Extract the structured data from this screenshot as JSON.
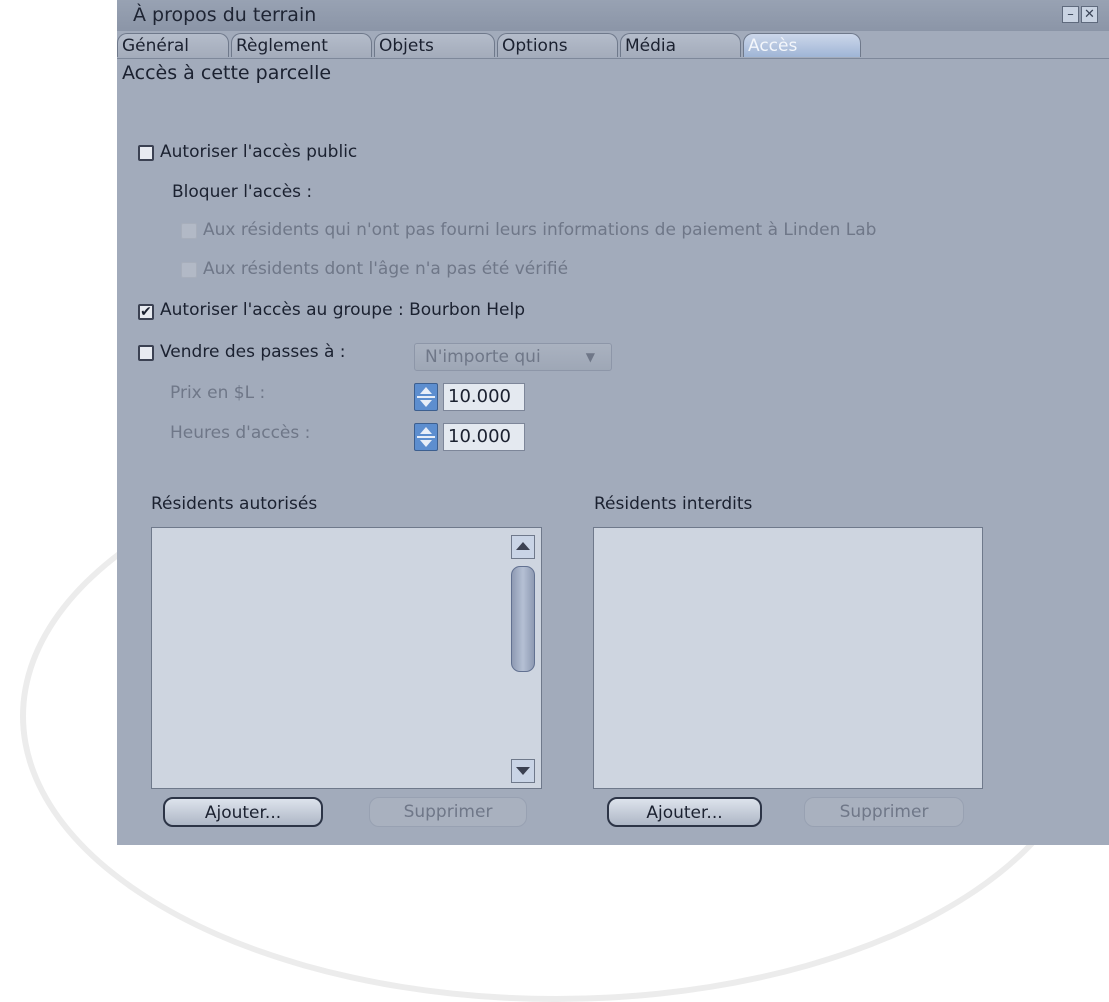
{
  "window": {
    "title": "À propos du terrain",
    "minimize_label": "–",
    "close_label": "✕"
  },
  "tabs": [
    {
      "label": "Général"
    },
    {
      "label": "Règlement"
    },
    {
      "label": "Objets"
    },
    {
      "label": "Options"
    },
    {
      "label": "Média"
    },
    {
      "label": "Accès",
      "active": true
    }
  ],
  "access": {
    "section_title": "Accès à cette parcelle",
    "public_access": {
      "label": "Autoriser l'accès public",
      "checked": false
    },
    "block_label": "Bloquer l'accès :",
    "block_no_payment": {
      "label": "Aux résidents qui n'ont pas fourni leurs informations de paiement à Linden Lab",
      "checked": false,
      "enabled": false
    },
    "block_age": {
      "label": "Aux résidents dont l'âge n'a pas été vérifié",
      "checked": false,
      "enabled": false
    },
    "group_access": {
      "label": "Autoriser l'accès au groupe : Bourbon Help",
      "checked": true
    },
    "sell_passes": {
      "label": "Vendre des passes à :",
      "checked": false
    },
    "sell_to_select": {
      "value": "N'importe qui"
    },
    "price": {
      "label": "Prix en $L :",
      "value": "10.000"
    },
    "hours": {
      "label": "Heures d'accès :",
      "value": "10.000"
    }
  },
  "allowed": {
    "title": "Résidents autorisés",
    "add_label": "Ajouter...",
    "remove_label": "Supprimer"
  },
  "banned": {
    "title": "Résidents interdits",
    "add_label": "Ajouter...",
    "remove_label": "Supprimer"
  },
  "icons": {
    "check": "checkmark-icon",
    "dropdown": "chevron-down-icon",
    "scroll_up": "arrow-up-icon",
    "scroll_down": "arrow-down-icon"
  },
  "colors": {
    "window_bg": "#a2abbb",
    "active_tab": "#9fb5d6",
    "spin_accent": "#5d8ecf"
  }
}
